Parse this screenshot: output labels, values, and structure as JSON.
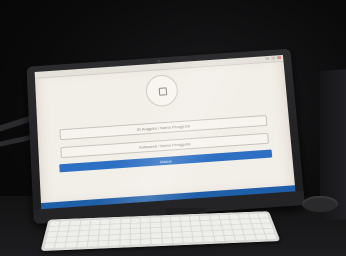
{
  "screen": {
    "username_placeholder": "ID Anggota / Nama Pengguna",
    "password_placeholder": "Katasandi / Nama Pengguna",
    "submit_label": "Masuk"
  },
  "colors": {
    "screen_background": "#f2eee8",
    "submit_button": "#2d6fc2",
    "taskbar": "#1f5ea8"
  },
  "icons": {
    "logo": "logo-icon"
  }
}
